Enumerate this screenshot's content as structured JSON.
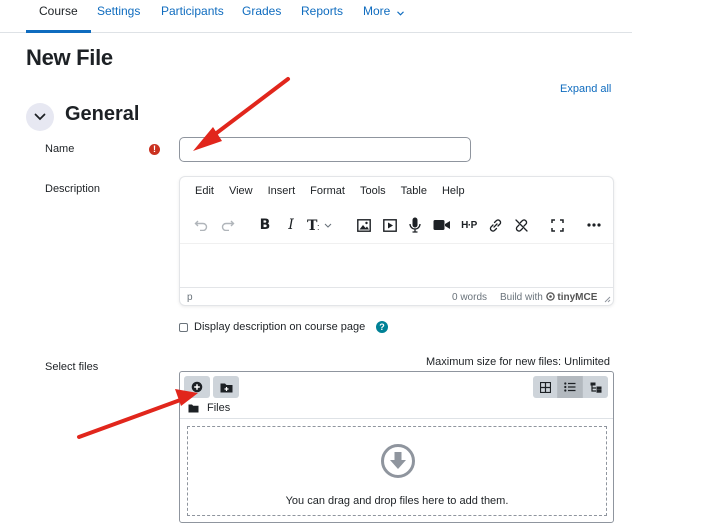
{
  "nav": {
    "tabs": [
      {
        "label": "Course"
      },
      {
        "label": "Settings"
      },
      {
        "label": "Participants"
      },
      {
        "label": "Grades"
      },
      {
        "label": "Reports"
      },
      {
        "label": "More"
      }
    ],
    "active_tab": "Course"
  },
  "page_title": "New File",
  "expand_all": "Expand all",
  "section": {
    "title": "General"
  },
  "form": {
    "name_label": "Name",
    "name_value": "",
    "description_label": "Description",
    "select_files_label": "Select files"
  },
  "editor": {
    "menu": [
      "Edit",
      "View",
      "Insert",
      "Format",
      "Tools",
      "Table",
      "Help"
    ],
    "toolbar_icons": [
      "undo-icon",
      "redo-icon",
      "bold-icon",
      "italic-icon",
      "text-style-icon",
      "image-icon",
      "media-icon",
      "record-audio-icon",
      "record-video-icon",
      "h5p-icon",
      "link-icon",
      "unlink-icon",
      "fullscreen-icon",
      "more-icon"
    ],
    "path": "p",
    "word_count": "0 words",
    "build_with": "Build with",
    "brand": "tinyMCE"
  },
  "checkbox": {
    "label": "Display description on course page",
    "checked": false
  },
  "filepicker": {
    "max_size": "Maximum size for new files: Unlimited",
    "folder": "Files",
    "drop_text": "You can drag and drop files here to add them.",
    "view_modes": [
      "icons-view-icon",
      "list-view-icon",
      "tree-view-icon"
    ],
    "active_view": "list-view-icon"
  },
  "colors": {
    "link": "#0f6cbf",
    "required": "#ca3120",
    "help": "#008196",
    "arrow": "#e1261c"
  }
}
